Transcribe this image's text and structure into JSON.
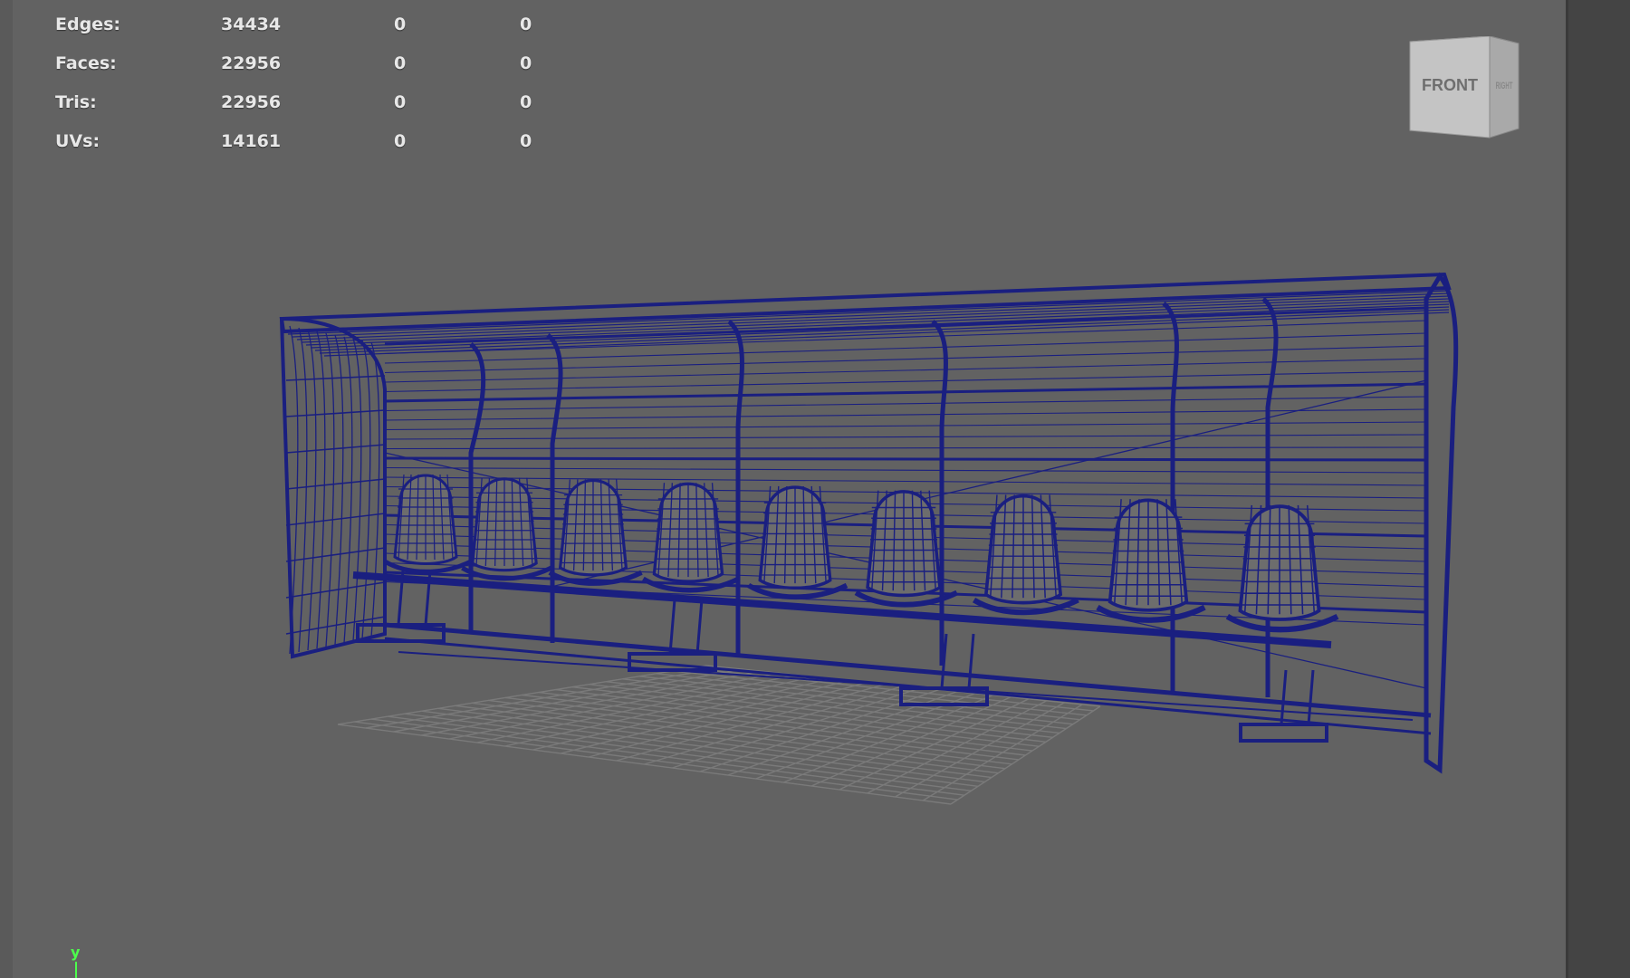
{
  "hud": {
    "rows": [
      {
        "label": "Edges:",
        "v1": "34434",
        "v2": "0",
        "v3": "0"
      },
      {
        "label": "Faces:",
        "v1": "22956",
        "v2": "0",
        "v3": "0"
      },
      {
        "label": "Tris:",
        "v1": "22956",
        "v2": "0",
        "v3": "0"
      },
      {
        "label": "UVs:",
        "v1": "14161",
        "v2": "0",
        "v3": "0"
      }
    ]
  },
  "viewcube": {
    "front": "FRONT",
    "right": "RIGHT"
  },
  "axis": {
    "y": "y"
  },
  "colors": {
    "wireframe": "#1a1f80",
    "viewport_bg": "#626262",
    "grid": "#7a7a7a",
    "axis_y": "#4cff4c"
  }
}
